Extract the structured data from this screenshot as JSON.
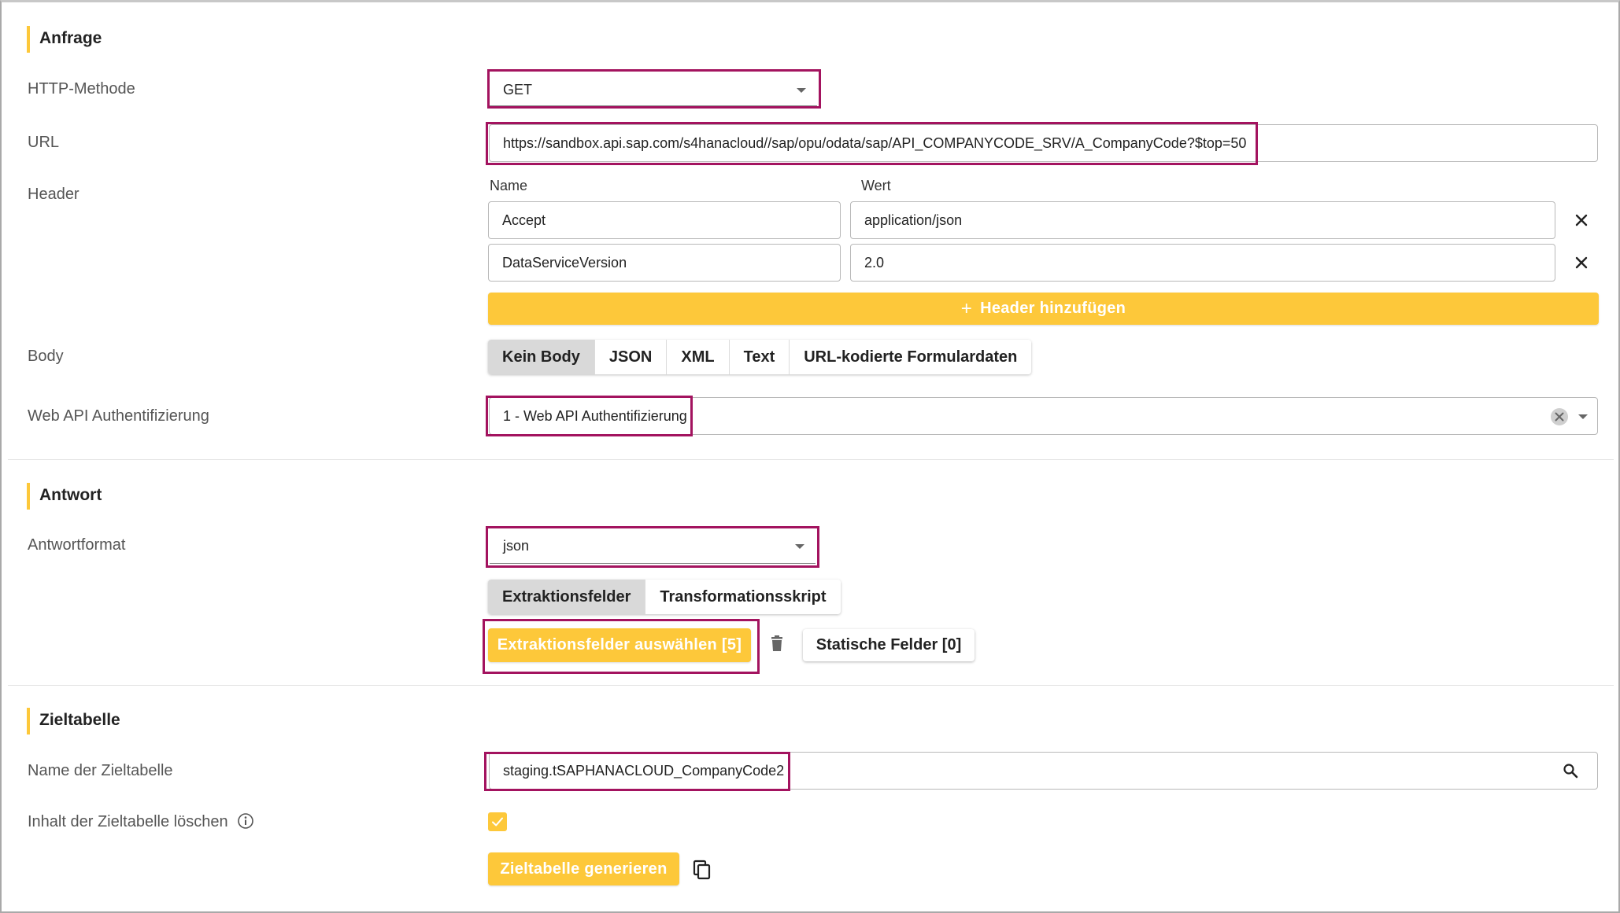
{
  "request": {
    "title": "Anfrage",
    "http_method": {
      "label": "HTTP-Methode",
      "value": "GET"
    },
    "url": {
      "label": "URL",
      "value": "https://sandbox.api.sap.com/s4hanacloud//sap/opu/odata/sap/API_COMPANYCODE_SRV/A_CompanyCode?$top=50"
    },
    "header": {
      "label": "Header",
      "name_col": "Name",
      "value_col": "Wert",
      "rows": [
        {
          "name": "Accept",
          "value": "application/json"
        },
        {
          "name": "DataServiceVersion",
          "value": "2.0"
        }
      ],
      "add_label": "Header hinzufügen"
    },
    "body": {
      "label": "Body",
      "options": [
        "Kein Body",
        "JSON",
        "XML",
        "Text",
        "URL-kodierte Formulardaten"
      ],
      "selected": "Kein Body"
    },
    "auth": {
      "label": "Web API Authentifizierung",
      "value": "1 - Web API Authentifizierung"
    }
  },
  "response": {
    "title": "Antwort",
    "format": {
      "label": "Antwortformat",
      "value": "json"
    },
    "tabs": [
      "Extraktionsfelder",
      "Transformationsskript"
    ],
    "selected_tab": "Extraktionsfelder",
    "select_fields_label": "Extraktionsfelder auswählen [5]",
    "static_fields_label": "Statische Felder [0]"
  },
  "target": {
    "title": "Zieltabelle",
    "table_name": {
      "label": "Name der Zieltabelle",
      "value": "staging.tSAPHANACLOUD_CompanyCode2"
    },
    "clear": {
      "label": "Inhalt der Zieltabelle löschen",
      "checked": true
    },
    "generate_label": "Zieltabelle generieren"
  },
  "colors": {
    "accent": "#fdc83a",
    "highlight": "#a3135f"
  }
}
